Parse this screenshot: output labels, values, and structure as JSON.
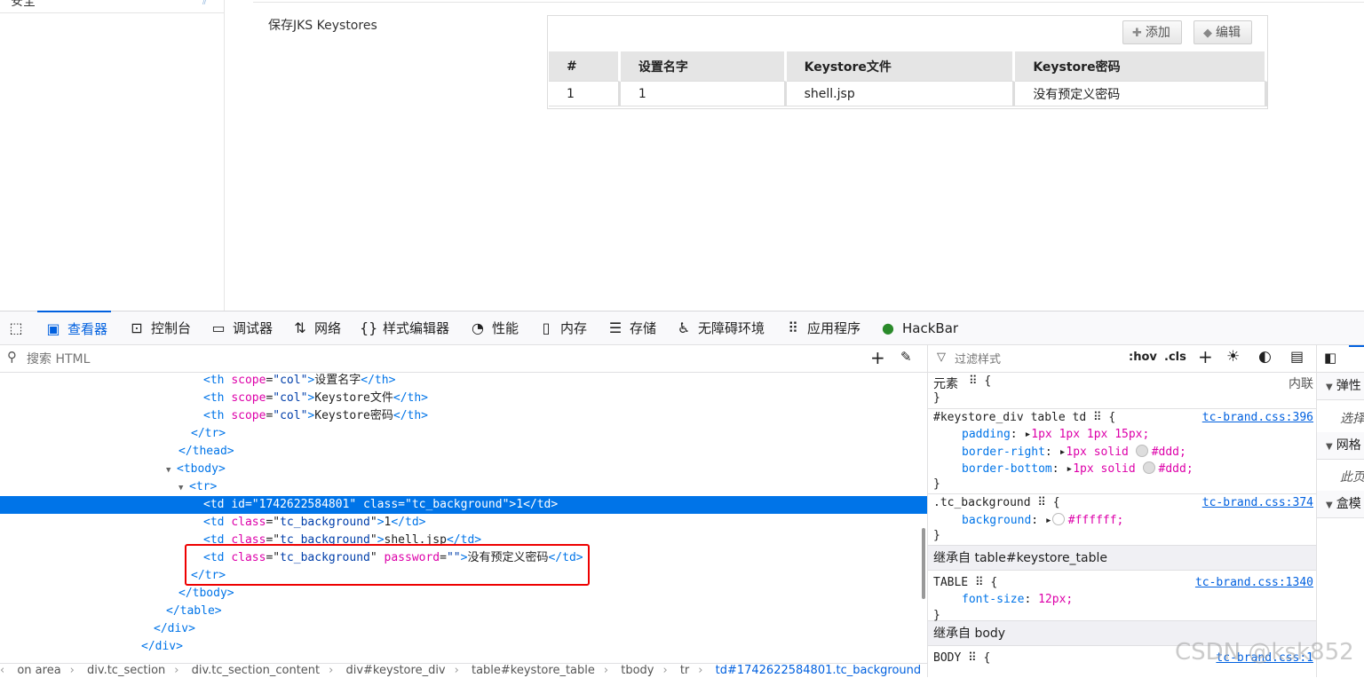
{
  "sidebar": {
    "cut_label": "安全",
    "cut_icon": "double-chevron-icon"
  },
  "keystore": {
    "label": "保存JKS Keystores",
    "add_button": "添加",
    "edit_button": "编辑",
    "columns": [
      "#",
      "设置名字",
      "Keystore文件",
      "Keystore密码"
    ],
    "rows": [
      [
        "1",
        "1",
        "shell.jsp",
        "没有预定义密码"
      ]
    ]
  },
  "devtools": {
    "tabs": [
      {
        "label": "查看器",
        "icon": "inspector-icon"
      },
      {
        "label": "控制台",
        "icon": "console-icon"
      },
      {
        "label": "调试器",
        "icon": "debugger-icon"
      },
      {
        "label": "网络",
        "icon": "network-icon"
      },
      {
        "label": "样式编辑器",
        "icon": "style-editor-icon"
      },
      {
        "label": "性能",
        "icon": "performance-icon"
      },
      {
        "label": "内存",
        "icon": "memory-icon"
      },
      {
        "label": "存储",
        "icon": "storage-icon"
      },
      {
        "label": "无障碍环境",
        "icon": "accessibility-icon"
      },
      {
        "label": "应用程序",
        "icon": "application-icon"
      },
      {
        "label": "HackBar",
        "icon": "hackbar-icon"
      }
    ],
    "search_placeholder": "搜索 HTML",
    "filter_placeholder": "过滤样式",
    "hov": ":hov",
    "cls": ".cls",
    "breadcrumbs": [
      "on area",
      "div.tc_section",
      "div.tc_section_content",
      "div#keystore_div",
      "table#keystore_table",
      "tbody",
      "tr",
      "td#1742622584801.tc_background"
    ]
  },
  "markup": [
    {
      "t": "<",
      "tag": "th",
      "attrs": [
        [
          "scope",
          "col"
        ]
      ],
      "text": "设置名字",
      "close": "th"
    },
    {
      "tag": "th",
      "attrs": [
        [
          "scope",
          "col"
        ]
      ],
      "text": "Keystore文件",
      "close": "th"
    },
    {
      "tag": "th",
      "attrs": [
        [
          "scope",
          "col"
        ]
      ],
      "text": "Keystore密码",
      "close": "th"
    }
  ],
  "tree_text": {
    "close_tr": "</tr>",
    "close_thead": "</thead>",
    "open_tbody": "<tbody>",
    "open_tr": "<tr>",
    "td_id_val": "1742622584801",
    "td_class_val": "tc_background",
    "td1_text": "1",
    "td2_text": "1",
    "td3_text": "shell.jsp",
    "td4_text": "没有预定义密码",
    "close_tbody": "</tbody>",
    "close_table": "</table>",
    "close_div": "</div>"
  },
  "rules": {
    "element_selector": "元素",
    "element_inline": "内联",
    "r1": {
      "selector": "#keystore_div table td",
      "source": "tc-brand.css:396",
      "decls": [
        {
          "p": "padding",
          "v": "1px 1px 1px 15px;"
        },
        {
          "p": "border-right",
          "v": "1px solid",
          "c": "#ddd;"
        },
        {
          "p": "border-bottom",
          "v": "1px solid",
          "c": "#ddd;"
        }
      ]
    },
    "r2": {
      "selector": ".tc_background",
      "source": "tc-brand.css:374",
      "decls": [
        {
          "p": "background",
          "c": "#ffffff;"
        }
      ]
    },
    "inherit1": "继承自 table#keystore_table",
    "r3": {
      "selector": "TABLE",
      "source": "tc-brand.css:1340",
      "decls": [
        {
          "p": "font-size",
          "v": "12px;"
        }
      ]
    },
    "inherit2": "继承自 body",
    "r4": {
      "selector": "BODY",
      "source": "tc-brand.css:1"
    }
  },
  "side": {
    "items": [
      "弹性",
      "网格",
      "盒模"
    ],
    "empties": [
      "选择",
      "此页"
    ]
  },
  "watermark": "CSDN @ksk852"
}
